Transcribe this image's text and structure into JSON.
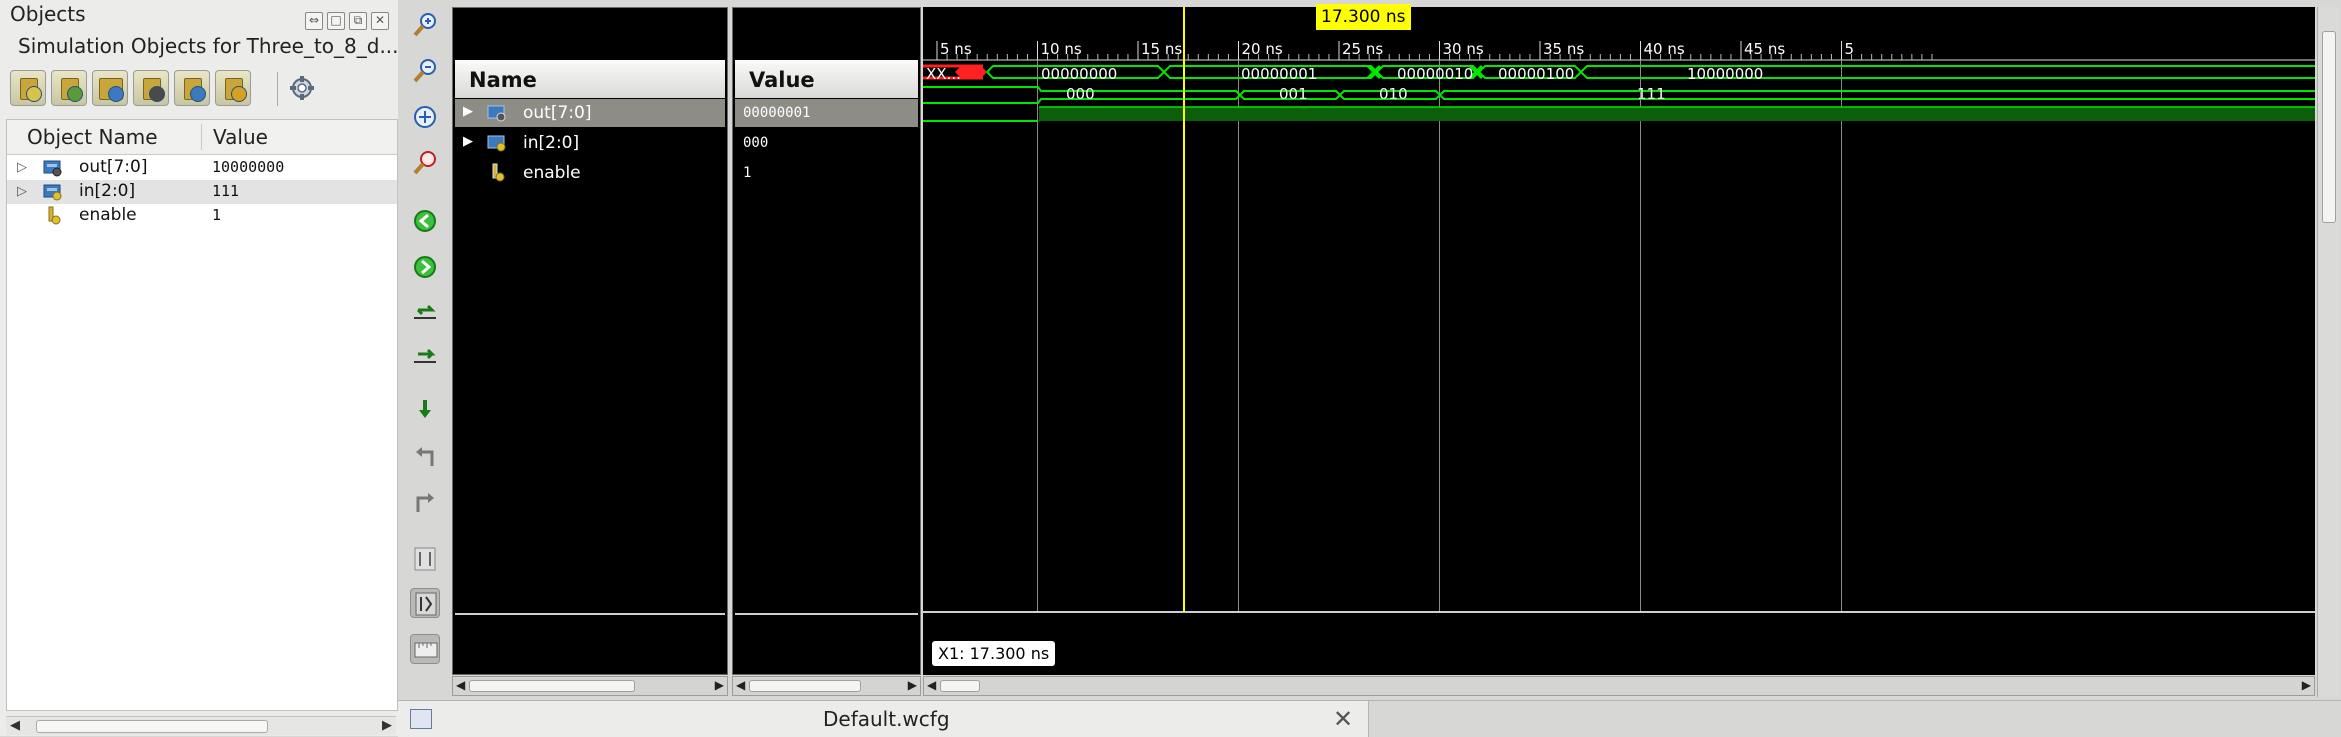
{
  "objects_panel": {
    "title": "Objects",
    "window_buttons": [
      "⇔",
      "□",
      "⧉",
      "✕"
    ],
    "subtitle": "Simulation Objects for Three_to_8_d...",
    "columns": [
      "Object Name",
      "Value"
    ],
    "rows": [
      {
        "name": "out[7:0]",
        "value": "10000000",
        "expandable": true,
        "selected": false
      },
      {
        "name": "in[2:0]",
        "value": "111",
        "expandable": true,
        "selected": true
      },
      {
        "name": "enable",
        "value": "1",
        "expandable": false,
        "selected": false
      }
    ]
  },
  "toolbar_icons": [
    "zoom-in-icon",
    "zoom-out-icon",
    "zoom-fit-icon",
    "zoom-to-cursor-icon",
    "go-to-time-zero-icon",
    "go-to-last-time-icon",
    "previous-transition-icon",
    "next-transition-icon",
    "add-marker-icon",
    "previous-marker-icon",
    "next-marker-icon",
    "swap-cursors-icon",
    "snap-to-transition-icon",
    "floating-ruler-icon"
  ],
  "wave": {
    "name_header": "Name",
    "value_header": "Value",
    "signals": [
      {
        "name": "out[7:0]",
        "value": "00000001",
        "expandable": true,
        "selected": true
      },
      {
        "name": "in[2:0]",
        "value": "000",
        "expandable": true,
        "selected": false
      },
      {
        "name": "enable",
        "value": "1",
        "expandable": false,
        "selected": false
      }
    ],
    "cursor_label": "17.300 ns",
    "x1_label": "X1: 17.300 ns",
    "time_ticks": [
      "5 ns",
      "10 ns",
      "15 ns",
      "20 ns",
      "25 ns",
      "30 ns",
      "35 ns",
      "40 ns",
      "45 ns",
      "5"
    ],
    "out_segment_labels": [
      "XX...",
      "00000000",
      "00000001",
      "00000010",
      "00000100",
      "10000000"
    ],
    "in_segment_labels": [
      "000",
      "001",
      "010",
      "111"
    ]
  },
  "tab": {
    "label": "Default.wcfg",
    "close": "✕"
  },
  "colors": {
    "wave_green": "#00e600",
    "cursor_yellow": "#ffff00",
    "undefined_red": "#ff2020",
    "high_fill": "#0b5f0b"
  }
}
